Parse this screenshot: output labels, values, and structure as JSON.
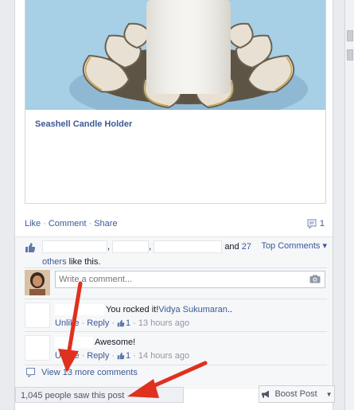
{
  "attachment": {
    "title": "Seashell Candle Holder"
  },
  "actions": {
    "like": "Like",
    "comment": "Comment",
    "share": "Share",
    "comment_count": "1"
  },
  "likes": {
    "sep1": ",",
    "sep2": ",",
    "and": "and",
    "others_count": "27",
    "others": "others",
    "suffix": "like this.",
    "top_comments": "Top Comments ▾"
  },
  "composer": {
    "placeholder": "Write a comment..."
  },
  "comments": [
    {
      "text": "You rocked it!",
      "mention": "Vidya Sukumaran",
      "trail": "..",
      "unlike": "Unlike",
      "reply": "Reply",
      "likes": "1",
      "time": "13 hours ago"
    },
    {
      "text": "Awesome!",
      "unlike": "Unlike",
      "reply": "Reply",
      "likes": "1",
      "time": "14 hours ago"
    }
  ],
  "view_more": "View 13 more comments",
  "seen": "1,045 people saw this post",
  "boost": "Boost Post",
  "colors": {
    "link": "#3b5998",
    "annotation_arrow": "#e0301e"
  }
}
